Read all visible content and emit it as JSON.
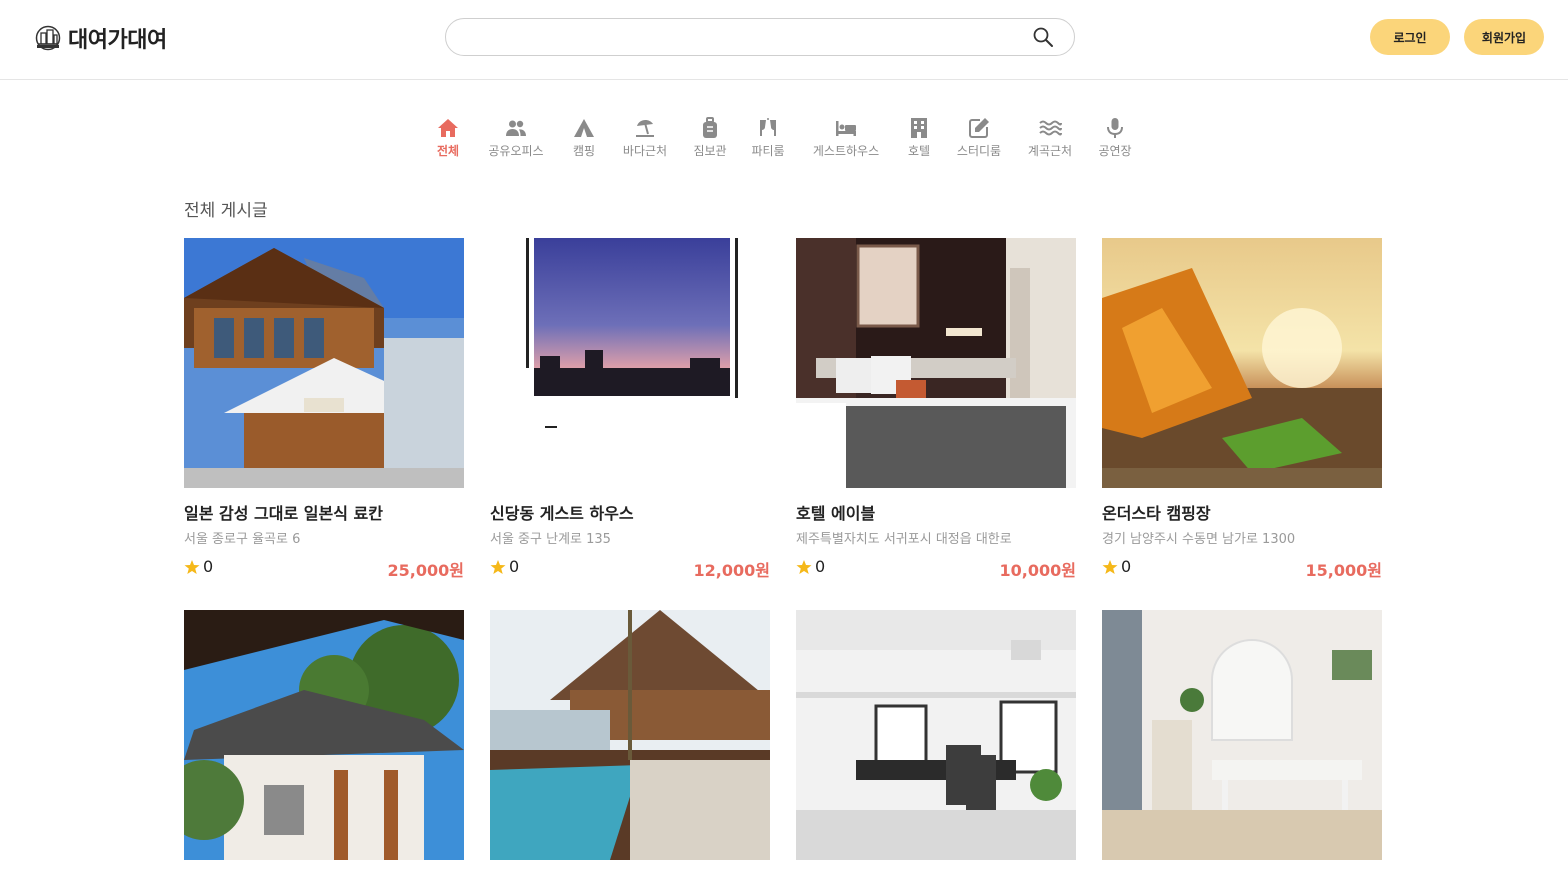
{
  "header": {
    "logo_text": "대여가대여",
    "search_placeholder": "",
    "login_label": "로그인",
    "signup_label": "회원가입"
  },
  "categories": [
    {
      "label": "전체",
      "icon": "home-icon",
      "active": true
    },
    {
      "label": "공유오피스",
      "icon": "users-icon",
      "active": false
    },
    {
      "label": "캠핑",
      "icon": "tent-icon",
      "active": false
    },
    {
      "label": "바다근처",
      "icon": "umbrella-beach-icon",
      "active": false
    },
    {
      "label": "짐보관",
      "icon": "luggage-icon",
      "active": false
    },
    {
      "label": "파티룸",
      "icon": "party-icon",
      "active": false
    },
    {
      "label": "게스트하우스",
      "icon": "bed-icon",
      "active": false
    },
    {
      "label": "호텔",
      "icon": "hotel-icon",
      "active": false
    },
    {
      "label": "스터디룸",
      "icon": "edit-icon",
      "active": false
    },
    {
      "label": "계곡근처",
      "icon": "water-icon",
      "active": false
    },
    {
      "label": "공연장",
      "icon": "microphone-icon",
      "active": false
    }
  ],
  "section_title": "전체 게시글",
  "listings": [
    {
      "title": "일본 감성 그대로 일본식 료칸",
      "address": "서울 종로구 율곡로 6",
      "rating": "0",
      "price": "25,000원"
    },
    {
      "title": "신당동 게스트 하우스",
      "address": "서울 중구 난계로 135",
      "rating": "0",
      "price": "12,000원"
    },
    {
      "title": "호텔 에이블",
      "address": "제주특별자치도 서귀포시 대정읍 대한로",
      "rating": "0",
      "price": "10,000원"
    },
    {
      "title": "온더스타 캠핑장",
      "address": "경기 남양주시 수동면 남가로 1300",
      "rating": "0",
      "price": "15,000원"
    }
  ],
  "colors": {
    "accent": "#e86b5f",
    "button": "#fbd57a",
    "icon_gray": "#8a8a8a",
    "star": "#f5b819"
  }
}
